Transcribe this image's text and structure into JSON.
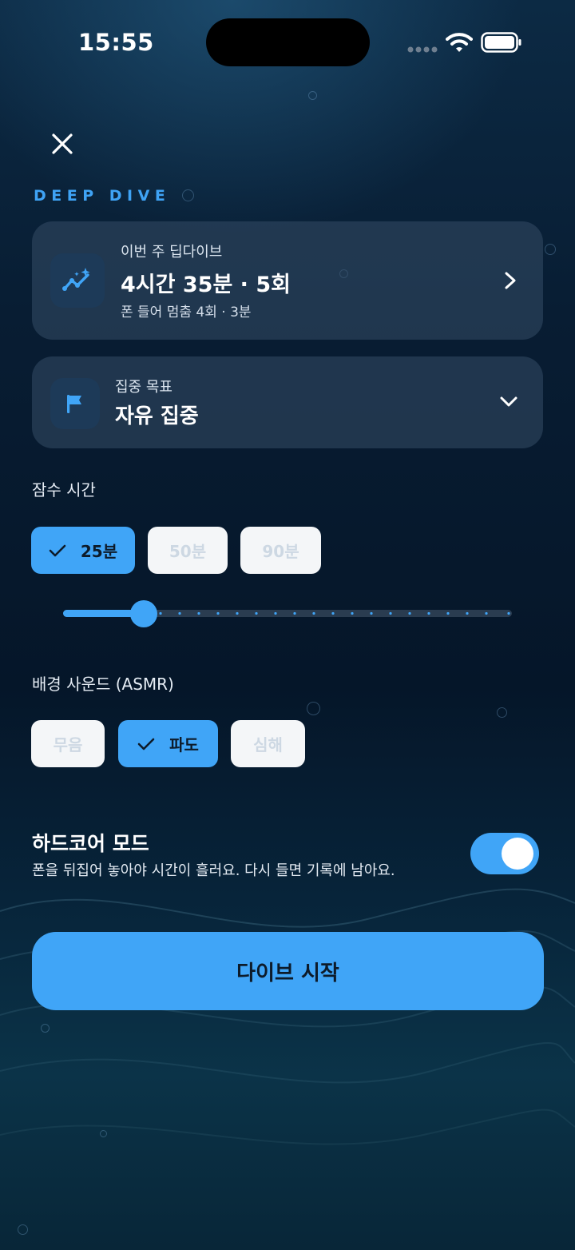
{
  "status_bar": {
    "time": "15:55"
  },
  "header": {
    "close_icon": "close-icon",
    "kicker": "DEEP DIVE"
  },
  "weekly_card": {
    "caption": "이번 주 딥다이브",
    "value": "4시간 35분 · 5회",
    "sub": "폰 들어 멈춤 4회 · 3분",
    "icon": "sparkle-chart-icon"
  },
  "goal_card": {
    "caption": "집중 목표",
    "value": "자유 집중",
    "icon": "flag-icon"
  },
  "duration": {
    "label": "잠수 시간",
    "options": [
      "25분",
      "50분",
      "90분"
    ],
    "selected_index": 0,
    "slider_fraction": 0.18
  },
  "sound": {
    "label": "배경 사운드 (ASMR)",
    "options": [
      "무음",
      "파도",
      "심해"
    ],
    "selected_index": 1
  },
  "hardcore": {
    "title": "하드코어 모드",
    "description": "폰을 뒤집어 놓아야 시간이 흘러요. 다시 들면 기록에 남아요.",
    "enabled": true
  },
  "start_button": {
    "label": "다이브 시작"
  },
  "colors": {
    "accent": "#40a5f7",
    "background": "#06182b",
    "card": "#2a4058"
  }
}
